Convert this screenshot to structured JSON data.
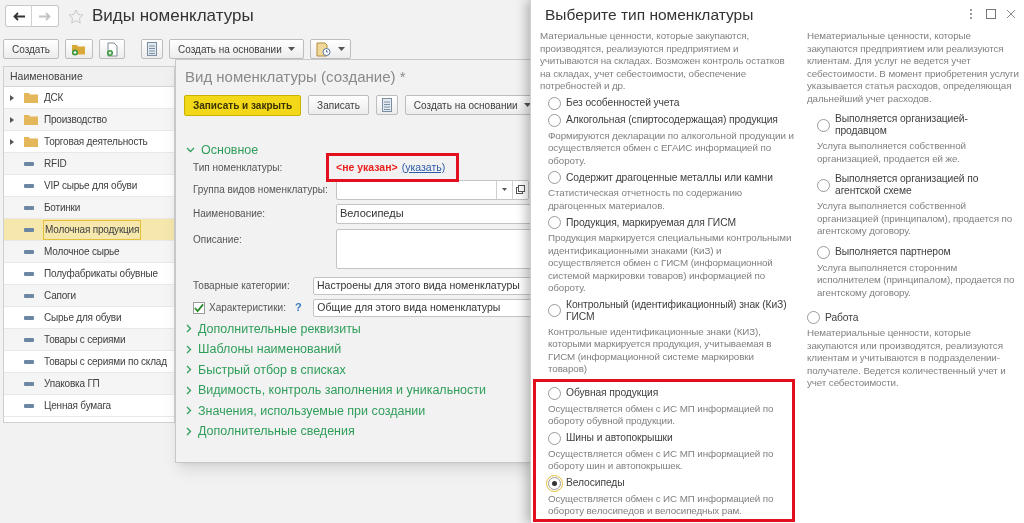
{
  "list_window": {
    "title": "Виды номенклатуры",
    "toolbar": [
      {
        "kind": "text",
        "label": "Создать"
      },
      {
        "kind": "folder-add"
      },
      {
        "kind": "doc-add"
      },
      {
        "kind": "list"
      },
      {
        "kind": "dropdown",
        "label": "Создать на основании"
      },
      {
        "kind": "report"
      }
    ],
    "column": "Наименование",
    "rows": [
      {
        "kind": "folder",
        "label": "ДСК",
        "expanded": false,
        "selected": false
      },
      {
        "kind": "folder",
        "label": "Производство",
        "expanded": false,
        "selected": false
      },
      {
        "kind": "folder",
        "label": "Торговая деятельность",
        "expanded": false,
        "selected": false
      },
      {
        "kind": "item",
        "label": "RFID",
        "selected": false
      },
      {
        "kind": "item",
        "label": "VIP сырье для обуви",
        "selected": false
      },
      {
        "kind": "item",
        "label": "Ботинки",
        "selected": false
      },
      {
        "kind": "item",
        "label": "Молочная продукция",
        "selected": true
      },
      {
        "kind": "item",
        "label": "Молочное сырье",
        "selected": false
      },
      {
        "kind": "item",
        "label": "Полуфабрикаты обувные",
        "selected": false
      },
      {
        "kind": "item",
        "label": "Сапоги",
        "selected": false
      },
      {
        "kind": "item",
        "label": "Сырье для обуви",
        "selected": false
      },
      {
        "kind": "item",
        "label": "Товары с сериями",
        "selected": false
      },
      {
        "kind": "item",
        "label": "Товары с сериями по склад",
        "selected": false
      },
      {
        "kind": "item",
        "label": "Упаковка ГП",
        "selected": false
      },
      {
        "kind": "item",
        "label": "Ценная бумага",
        "selected": false
      }
    ]
  },
  "form": {
    "title": "Вид номенклатуры (создание) *",
    "buttons": [
      {
        "kind": "primary",
        "label": "Записать и закрыть"
      },
      {
        "kind": "text",
        "label": "Записать"
      },
      {
        "kind": "list"
      },
      {
        "kind": "dropdown",
        "label": "Создать на основании"
      }
    ],
    "main_section": {
      "label": "Основное",
      "expanded": true
    },
    "type_field": {
      "label": "Тип номенклатуры:",
      "value": "<не указан>",
      "link": "(указать)",
      "highlighted": true
    },
    "group_field": {
      "label": "Группа видов номенклатуры:"
    },
    "name_field": {
      "label": "Наименование:",
      "value": "Велосипеды"
    },
    "description_field": {
      "label": "Описание:"
    },
    "categories_field": {
      "label": "Товарные категории:",
      "value": "Настроены для этого вида номенклатуры"
    },
    "characteristics_field": {
      "label": "Характеристики:",
      "checked": true,
      "help": "?",
      "value": "Общие для этого вида номенклатуры"
    },
    "sections": [
      {
        "label": "Дополнительные реквизиты",
        "expanded": false
      },
      {
        "label": "Шаблоны наименований",
        "expanded": false
      },
      {
        "label": "Быстрый отбор в списках",
        "expanded": false
      },
      {
        "label": "Видимость, контроль заполнения и уникальности",
        "expanded": false
      },
      {
        "label": "Значения, используемые при создании",
        "expanded": false
      },
      {
        "label": "Дополнительные сведения",
        "expanded": false
      }
    ]
  },
  "dialog": {
    "title": "Выберите тип номенклатуры",
    "goods": {
      "description": "Материальные ценности, которые закупаются, производятся, реализуются предприятием и учитываются на складах. Возможен контроль остатков на складах, учет себестоимости, обеспечение потребностей и др.",
      "options": [
        {
          "label": "Без особенностей учета",
          "selected": false
        },
        {
          "label": "Алкогольная (спиртосодержащая) продукция",
          "description": "Формируются декларации по алкогольной продукции и осуществляется обмен с ЕГАИС информацией по обороту.",
          "selected": false
        },
        {
          "label": "Содержит драгоценные металлы или камни",
          "description": "Статистическая отчетность по содержанию драгоценных материалов.",
          "selected": false
        },
        {
          "label": "Продукция, маркируемая для ГИСМ",
          "description": "Продукция маркируется специальными контрольными идентификационными знаками (КиЗ) и осуществляется обмен с ГИСМ (информационной системой маркировки товаров) информацией по обороту.",
          "selected": false
        },
        {
          "label": "Контрольный (идентификационный) знак (КиЗ) ГИСМ",
          "description": "Контрольные идентификационные знаки (КИЗ), которыми маркируется продукция, учитываемая в ГИСМ (информационной системе маркировки товаров)",
          "selected": false
        }
      ]
    },
    "marked_goods": {
      "highlighted": true,
      "options": [
        {
          "label": "Обувная продукция",
          "description": "Осуществляется обмен с ИС МП информацией по обороту обувной продукции.",
          "selected": false
        },
        {
          "label": "Шины и автопокрышки",
          "description": "Осуществляется обмен с ИС МП информацией по обороту шин и автопокрышек.",
          "selected": false
        },
        {
          "label": "Велосипеды",
          "description": "Осуществляется обмен с ИС МП информацией по обороту велосипедов и велосипедных рам.",
          "selected": true
        }
      ]
    },
    "services": {
      "description": "Нематериальные ценности, которые закупаются предприятием или реализуются клиентам. Для услуг не ведется учет себестоимости. В момент приобретения услуги указывается статья расходов, определяющая дальнейший учет расходов.",
      "options": [
        {
          "label": "Выполняется организацией-продавцом",
          "description": "Услуга выполняется собственной организацией, продается ей же.",
          "selected": false
        },
        {
          "label": "Выполняется организацией по агентской схеме",
          "description": "Услуга выполняется собственной организацией (принципалом), продается по агентскому договору.",
          "selected": false
        },
        {
          "label": "Выполняется партнером",
          "description": "Услуга выполняется сторонним исполнителем (принципалом), продается по агентскому договору.",
          "selected": false
        }
      ]
    },
    "work": {
      "label": "Работа",
      "description": "Нематериальные ценности, которые закупаются или производятся, реализуются клиентам и учитываются в подразделении-получателе. Ведется количественный учет и учет себестоимости.",
      "selected": false
    }
  }
}
